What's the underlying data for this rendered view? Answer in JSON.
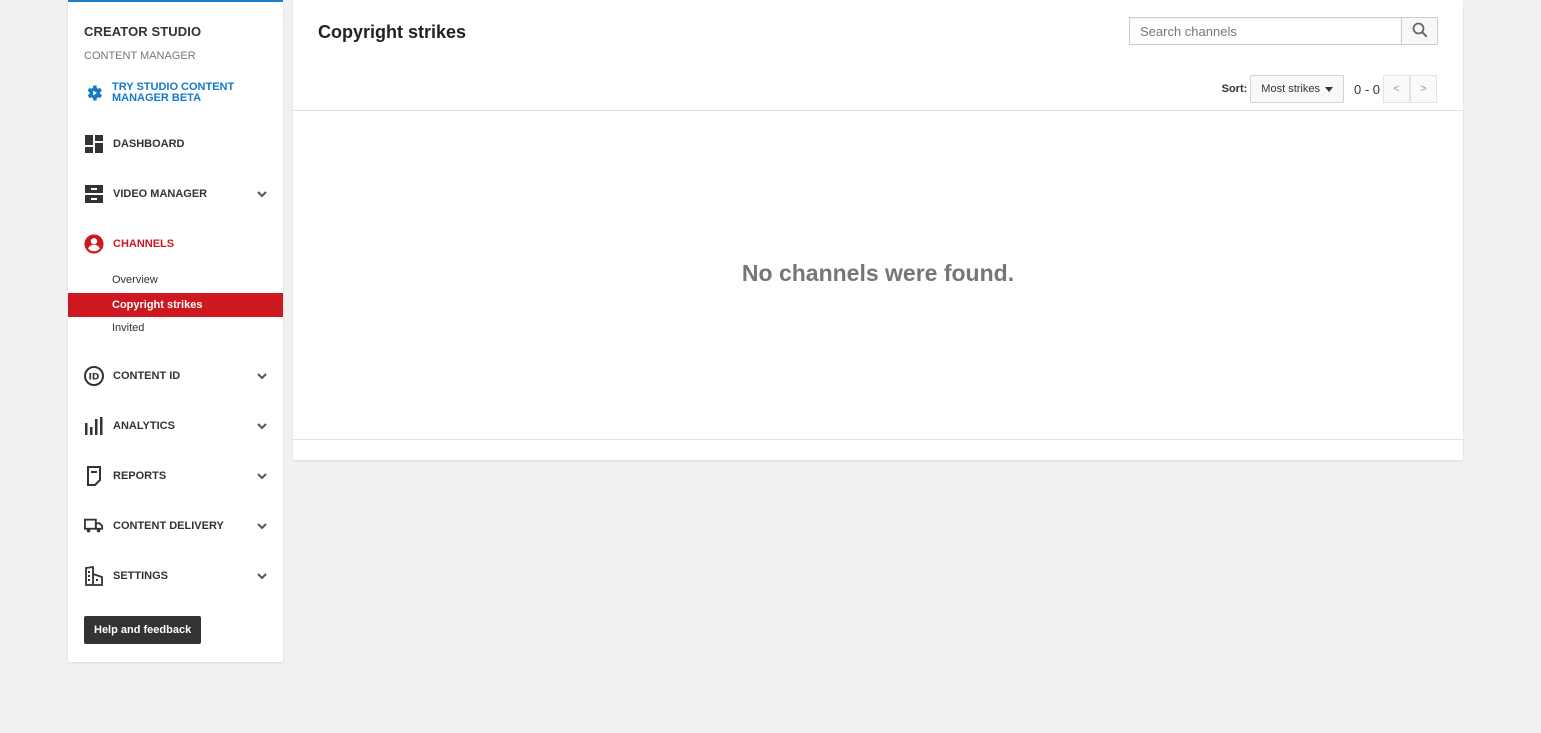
{
  "sidebar": {
    "brand": "CREATOR STUDIO",
    "subtitle": "CONTENT MANAGER",
    "beta_link": "TRY STUDIO CONTENT MANAGER BETA",
    "items": [
      {
        "label": "DASHBOARD",
        "icon": "dashboard-icon"
      },
      {
        "label": "VIDEO MANAGER",
        "icon": "video-manager-icon"
      },
      {
        "label": "CHANNELS",
        "icon": "channels-icon",
        "active": true
      },
      {
        "label": "CONTENT ID",
        "icon": "content-id-icon"
      },
      {
        "label": "ANALYTICS",
        "icon": "analytics-icon"
      },
      {
        "label": "REPORTS",
        "icon": "reports-icon"
      },
      {
        "label": "CONTENT DELIVERY",
        "icon": "truck-icon"
      },
      {
        "label": "SETTINGS",
        "icon": "building-icon"
      }
    ],
    "channel_subitems": [
      "Overview",
      "Copyright strikes",
      "Invited"
    ],
    "help_button": "Help and feedback"
  },
  "main": {
    "title": "Copyright strikes",
    "search_placeholder": "Search channels",
    "sort_label": "Sort:",
    "sort_value": "Most strikes",
    "range": "0 - 0",
    "prev": "<",
    "next": ">",
    "empty_message": "No channels were found."
  },
  "colors": {
    "accent_red": "#cc181e",
    "link_blue": "#167ac6",
    "top_border_blue": "#1e7ccf"
  }
}
